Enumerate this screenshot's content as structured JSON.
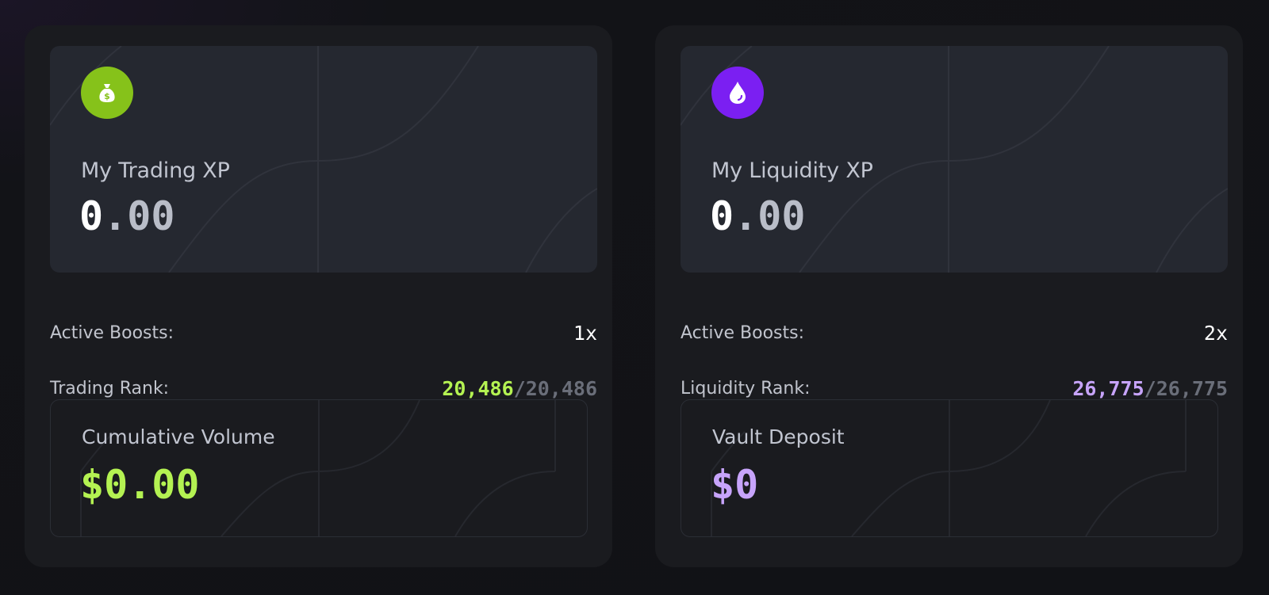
{
  "trading": {
    "title": "My Trading XP",
    "xp_int": "0",
    "xp_frac": ".00",
    "boosts_label": "Active Boosts:",
    "boosts_value": "1x",
    "rank_label": "Trading Rank:",
    "rank_current": "20,486",
    "rank_sep": "/",
    "rank_total": "20,486",
    "stat_label": "Cumulative Volume",
    "stat_value": "$0.00",
    "icon": "money-bag-icon",
    "accent": "#b4f252",
    "icon_bg": "#86c21a"
  },
  "liquidity": {
    "title": "My Liquidity XP",
    "xp_int": "0",
    "xp_frac": ".00",
    "boosts_label": "Active Boosts:",
    "boosts_value": "2x",
    "rank_label": "Liquidity Rank:",
    "rank_current": "26,775",
    "rank_sep": "/",
    "rank_total": "26,775",
    "stat_label": "Vault Deposit",
    "stat_value": "$0",
    "icon": "droplet-icon",
    "accent": "#c7a4fb",
    "icon_bg": "#7b1ff2"
  }
}
